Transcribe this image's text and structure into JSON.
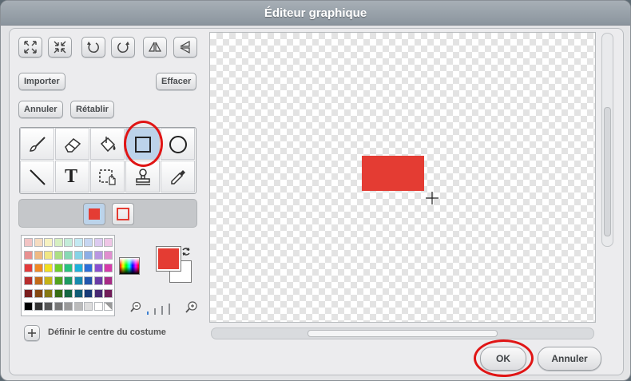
{
  "window": {
    "title": "Éditeur graphique"
  },
  "toolbar": {
    "buttons": [
      {
        "name": "zoom-expand-icon"
      },
      {
        "name": "zoom-shrink-icon"
      },
      {
        "name": "rotate-left-icon"
      },
      {
        "name": "rotate-right-icon"
      },
      {
        "name": "flip-horizontal-icon"
      },
      {
        "name": "flip-vertical-icon"
      }
    ],
    "import_label": "Importer",
    "clear_label": "Effacer",
    "undo_label": "Annuler",
    "redo_label": "Rétablir"
  },
  "tools": {
    "items": [
      "brush-icon",
      "eraser-icon",
      "fill-bucket-icon",
      "rectangle-icon",
      "ellipse-icon",
      "line-icon",
      "text-icon",
      "select-icon",
      "stamp-icon",
      "eyedropper-icon"
    ],
    "selected": "rectangle-icon",
    "text_tool_glyph": "T"
  },
  "fill_mode": {
    "options": [
      "filled-rectangle",
      "outlined-rectangle"
    ],
    "selected": "filled-rectangle"
  },
  "palette": {
    "rows": [
      [
        "#f2c4c4",
        "#f6dcc0",
        "#f7f2c0",
        "#d6efc0",
        "#c3ecd9",
        "#c3e9f2",
        "#c6d6f2",
        "#dccaf0",
        "#efc6e6"
      ],
      [
        "#e89090",
        "#efb983",
        "#f0e684",
        "#addf84",
        "#88d9b4",
        "#87d3e6",
        "#8caee6",
        "#b997e1",
        "#e08fcf"
      ],
      [
        "#e33b3b",
        "#f08a24",
        "#f1df1f",
        "#6fce2b",
        "#27c27f",
        "#1fb1dc",
        "#2d6fd9",
        "#8a4fd0",
        "#d63aa9"
      ],
      [
        "#b72e2e",
        "#c26c1a",
        "#c4b317",
        "#52a31f",
        "#1d9a62",
        "#178aae",
        "#2356ad",
        "#6b3ca6",
        "#a82c86"
      ],
      [
        "#7a1e1e",
        "#844812",
        "#857811",
        "#376d15",
        "#146642",
        "#105c75",
        "#173a76",
        "#472872",
        "#711d59"
      ],
      [
        "#000000",
        "#333333",
        "#555555",
        "#777777",
        "#999999",
        "#bbbbbb",
        "#dddddd",
        "#ffffff",
        "pattern"
      ]
    ]
  },
  "colors": {
    "primary": "#e43c33",
    "secondary": "#ffffff",
    "canvas_shape": "#e43c33",
    "annotation": "#e01515"
  },
  "set_center_label": "Définir le centre du costume",
  "dialog": {
    "ok_label": "OK",
    "cancel_label": "Annuler"
  }
}
